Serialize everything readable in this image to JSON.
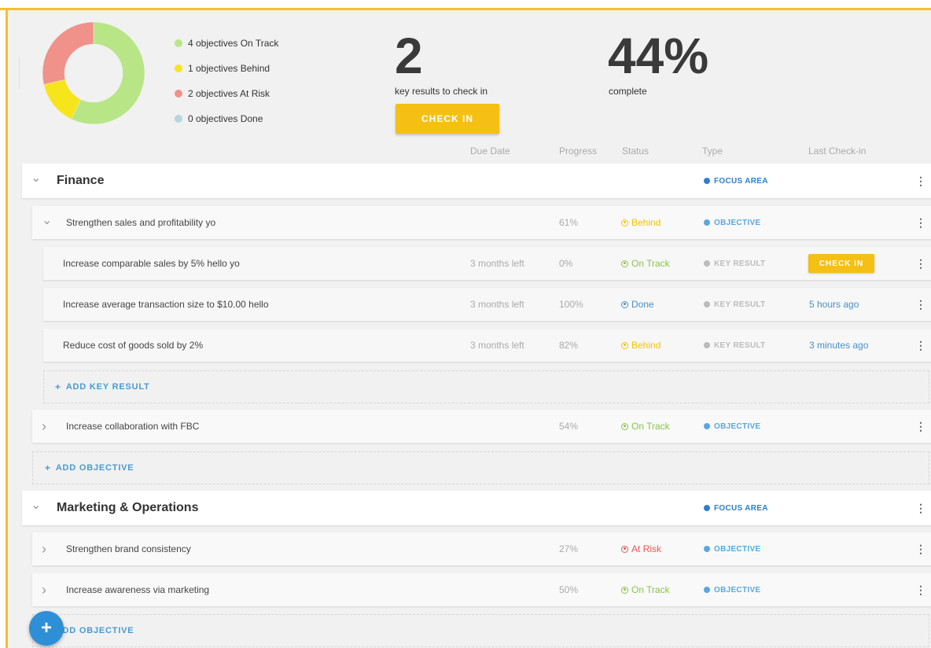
{
  "colors": {
    "on_track": "#8bc34a",
    "behind": "#f2c400",
    "at_risk": "#ef5350",
    "done": "#4a90c8",
    "focus_area": "#2f80c8",
    "objective": "#5aa7e0",
    "key_result": "#bbbbbb",
    "accent": "#f5c013",
    "link": "#4a9ad4"
  },
  "summary": {
    "legend": [
      {
        "label": "4 objectives On Track",
        "color": "#b8e586"
      },
      {
        "label": "1 objectives Behind",
        "color": "#f7e51c"
      },
      {
        "label": "2 objectives At Risk",
        "color": "#f0918a"
      },
      {
        "label": "0 objectives Done",
        "color": "#b8d4de"
      }
    ],
    "key_results_count": "2",
    "key_results_label": "key results to check in",
    "checkin_label": "CHECK IN",
    "complete_percent": "44%",
    "complete_label": "complete"
  },
  "chart_data": {
    "type": "pie",
    "categories": [
      "On Track",
      "Behind",
      "At Risk",
      "Done"
    ],
    "values": [
      4,
      1,
      2,
      0
    ],
    "colors": [
      "#b8e586",
      "#f7e51c",
      "#f0918a",
      "#b8d4de"
    ]
  },
  "columns": {
    "due_date": "Due Date",
    "progress": "Progress",
    "status": "Status",
    "type": "Type",
    "last_checkin": "Last Check-in"
  },
  "labels": {
    "add_key_result": "ADD KEY RESULT",
    "add_objective": "ADD OBJECTIVE",
    "focus_area": "FOCUS AREA",
    "objective": "OBJECTIVE",
    "key_result": "KEY RESULT",
    "check_in": "CHECK IN"
  },
  "rows": [
    {
      "kind": "focus",
      "title": "Finance"
    },
    {
      "kind": "objective",
      "title": "Strengthen sales and profitability yo",
      "expanded": true,
      "progress": "61%",
      "status": "Behind"
    },
    {
      "kind": "kr",
      "title": "Increase comparable sales by 5% hello yo",
      "due": "3 months left",
      "progress": "0%",
      "status": "On Track",
      "last": ""
    },
    {
      "kind": "kr",
      "title": "Increase average transaction size to $10.00 hello",
      "due": "3 months left",
      "progress": "100%",
      "status": "Done",
      "last": "5 hours ago"
    },
    {
      "kind": "kr",
      "title": "Reduce cost of goods sold by 2%",
      "due": "3 months left",
      "progress": "82%",
      "status": "Behind",
      "last": "3 minutes ago"
    },
    {
      "kind": "add_kr"
    },
    {
      "kind": "objective",
      "title": "Increase collaboration with FBC",
      "expanded": false,
      "progress": "54%",
      "status": "On Track"
    },
    {
      "kind": "add_obj"
    },
    {
      "kind": "focus",
      "title": "Marketing & Operations"
    },
    {
      "kind": "objective",
      "title": "Strengthen brand consistency",
      "expanded": false,
      "progress": "27%",
      "status": "At Risk"
    },
    {
      "kind": "objective",
      "title": "Increase awareness via marketing",
      "expanded": false,
      "progress": "50%",
      "status": "On Track"
    },
    {
      "kind": "add_obj"
    }
  ],
  "fab_icon": "plus-icon"
}
